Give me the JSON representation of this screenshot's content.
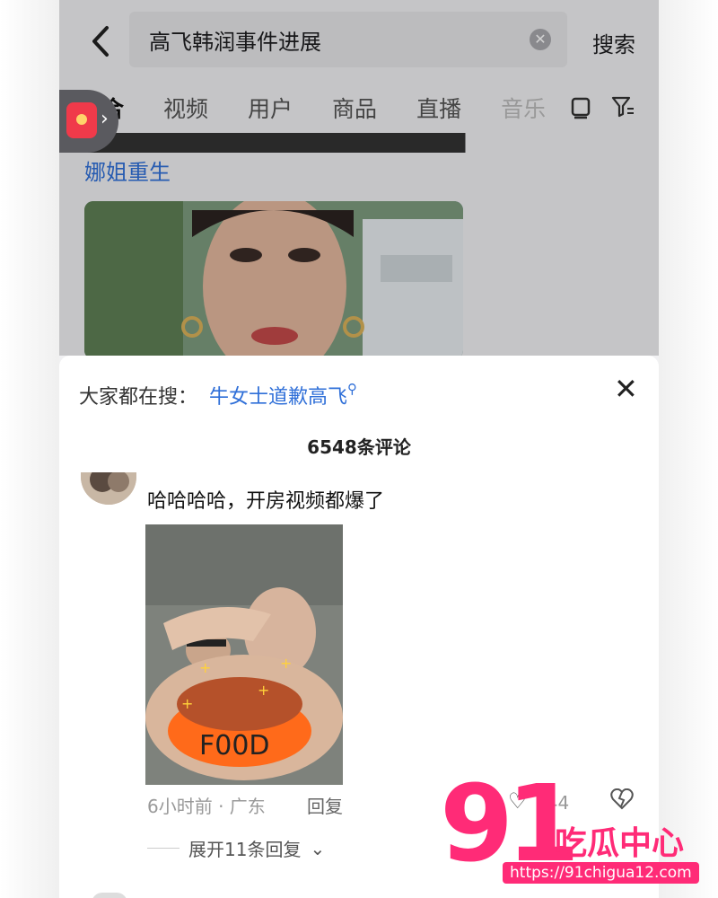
{
  "header": {
    "back_icon": "chevron-left-icon",
    "search_value": "高飞韩润事件进展",
    "clear_icon": "clear-icon",
    "search_button": "搜索"
  },
  "tabs": [
    {
      "label": "综合",
      "active": true
    },
    {
      "label": "视频"
    },
    {
      "label": "用户"
    },
    {
      "label": "商品"
    },
    {
      "label": "直播"
    },
    {
      "label": "音乐"
    }
  ],
  "tab_icons": [
    "card-view-icon",
    "filter-icon"
  ],
  "feed": {
    "line2": "娜姐重生"
  },
  "comments_sheet": {
    "hot_search_label": "大家都在搜：",
    "hot_search_link": "牛女士道歉高飞",
    "comment_count": "6548条评论",
    "comment": {
      "text": "哈哈哈哈，开房视频都爆了",
      "time_location": "6小时前 · 广东",
      "reply_label": "回复",
      "likes": "744",
      "expand_label": "展开11条回复"
    }
  },
  "watermark": {
    "logo_text": "91",
    "name": "吃瓜中心",
    "url": "https://91chigua12.com"
  },
  "colors": {
    "link_blue": "#2f6fd8",
    "watermark_pink": "#ff2b77",
    "sheet_bg": "#ffffff"
  }
}
